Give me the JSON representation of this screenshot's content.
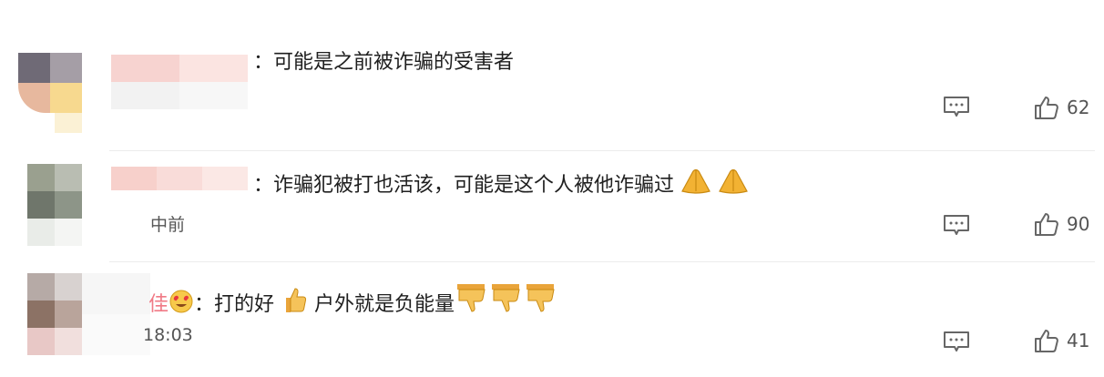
{
  "comments": [
    {
      "text": "：可能是之前被诈骗的受害者",
      "likes": "62"
    },
    {
      "text": "：诈骗犯被打也活该，可能是这个人被他诈骗过",
      "time": "中前",
      "likes": "90"
    },
    {
      "text_a": "：打的好",
      "text_b": "户外就是负能量",
      "name_partial": "佳",
      "time": "18:03",
      "likes": "41"
    }
  ],
  "icons": {
    "reply": "comment-reply-icon",
    "like": "thumbs-up-icon",
    "emojis": [
      "pray-hands-icon",
      "thumbs-up-emoji-icon",
      "thumbs-down-emoji-icon",
      "heart-eyes-emoji-icon"
    ]
  },
  "colors": {
    "text": "#1f1f1f",
    "meta": "#555555",
    "icon": "#666666",
    "emoji": "#f2b233"
  }
}
